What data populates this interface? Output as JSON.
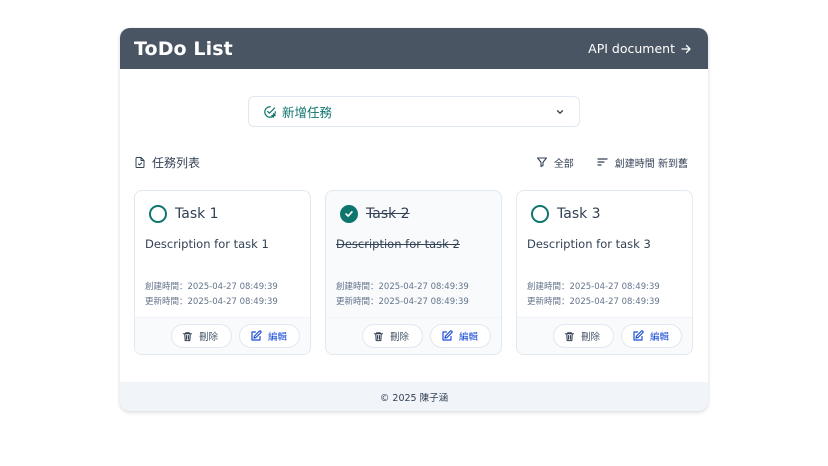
{
  "header": {
    "title": "ToDo List",
    "api_link": "API document"
  },
  "add_task": {
    "label": "新增任務"
  },
  "toolbar": {
    "list_title": "任務列表",
    "filter_label": "全部",
    "sort_label": "創建時間 新到舊"
  },
  "tasks": [
    {
      "title": "Task 1",
      "description": "Description for task 1",
      "completed": false,
      "created": "創建時間：2025-04-27 08:49:39",
      "updated": "更新時間：2025-04-27 08:49:39",
      "delete_label": "刪除",
      "edit_label": "編輯"
    },
    {
      "title": "Task 2",
      "description": "Description for task 2",
      "completed": true,
      "created": "創建時間：2025-04-27 08:49:39",
      "updated": "更新時間：2025-04-27 08:49:39",
      "delete_label": "刪除",
      "edit_label": "編輯"
    },
    {
      "title": "Task 3",
      "description": "Description for task 3",
      "completed": false,
      "created": "創建時間：2025-04-27 08:49:39",
      "updated": "更新時間：2025-04-27 08:49:39",
      "delete_label": "刪除",
      "edit_label": "編輯"
    }
  ],
  "footer": {
    "copyright": "© 2025 陳子涵"
  },
  "colors": {
    "header_bg": "#4a5563",
    "accent_teal": "#0f766e",
    "edit_blue": "#1d4ed8",
    "footer_bg": "#f1f5f9"
  },
  "icons": [
    "arrow-right-icon",
    "calendar-check-icon",
    "chevron-down-icon",
    "file-check-icon",
    "filter-icon",
    "sort-icon",
    "check-icon",
    "trash-icon",
    "edit-icon"
  ]
}
